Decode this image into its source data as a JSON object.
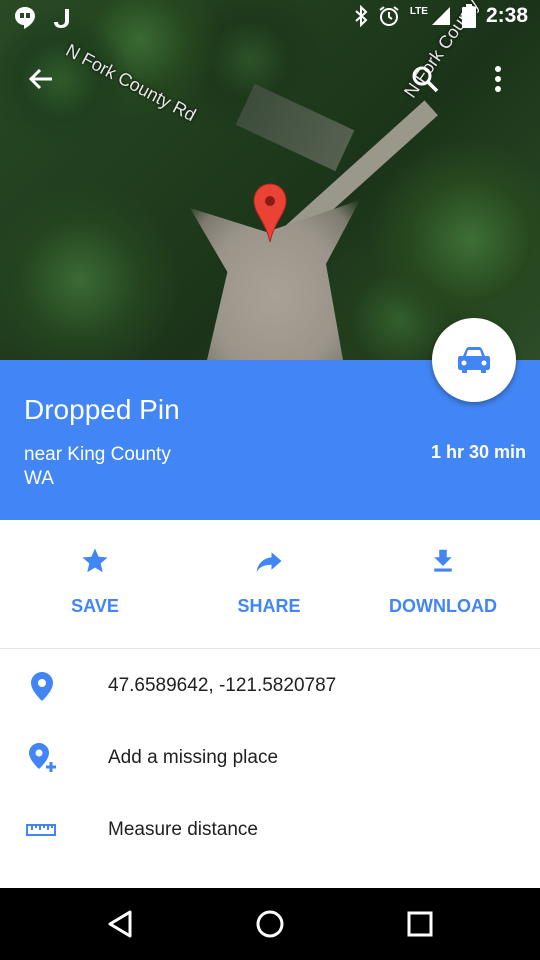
{
  "status_bar": {
    "time": "2:38",
    "network": "LTE",
    "icons": [
      "hangouts-icon",
      "j-app-icon",
      "bluetooth-icon",
      "alarm-icon",
      "signal-icon",
      "battery-icon"
    ]
  },
  "map": {
    "road_labels": [
      "N Fork County Rd",
      "N Fork County"
    ],
    "pin_color": "#ea4335"
  },
  "place": {
    "title": "Dropped Pin",
    "subtitle_line1": "near King County",
    "subtitle_line2": "WA",
    "eta": "1 hr 30 min",
    "header_color": "#4285f4"
  },
  "actions": [
    {
      "label": "SAVE",
      "icon": "star-icon"
    },
    {
      "label": "SHARE",
      "icon": "share-icon"
    },
    {
      "label": "DOWNLOAD",
      "icon": "download-icon"
    }
  ],
  "details": [
    {
      "text": "47.6589642, -121.5820787",
      "icon": "location-pin-icon"
    },
    {
      "text": "Add a missing place",
      "icon": "add-place-icon"
    },
    {
      "text": "Measure distance",
      "icon": "ruler-icon"
    }
  ],
  "nav_bar": {
    "buttons": [
      "back-icon",
      "home-icon",
      "recents-icon"
    ]
  }
}
